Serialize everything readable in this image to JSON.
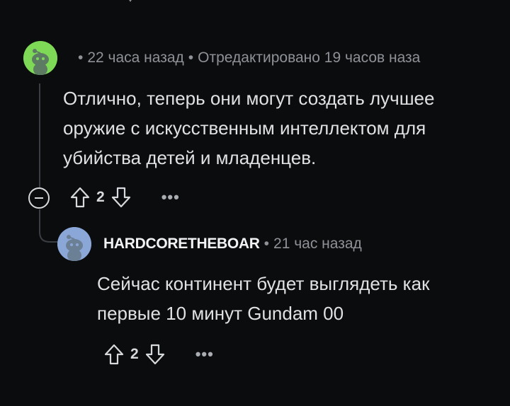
{
  "comment1": {
    "avatar_icon": "snoo-avatar-green",
    "avatar_color": "#7ed957",
    "time": "22 часа назад",
    "edited": "Отредактировано 19 часов наза",
    "body_lines": [
      "Отлично, теперь они могут создать лучшее",
      "оружие с искусственным интеллектом для",
      "убийства детей и младенцев."
    ],
    "votes": "2",
    "more": "•••"
  },
  "reply1": {
    "avatar_icon": "snoo-avatar-blue",
    "avatar_color": "#8aa7d8",
    "username": "HARDCORETHEBOAR",
    "time": "21 час назад",
    "body_lines": [
      "Сейчас континент будет выглядеть как",
      "первые 10 минут Gundam 00"
    ],
    "votes": "2",
    "more": "•••"
  },
  "separator": "•",
  "colors": {
    "background": "#0b0c0e",
    "meta": "#8e9296",
    "text": "#dfe1e3",
    "thread_line": "#3a3d41"
  }
}
